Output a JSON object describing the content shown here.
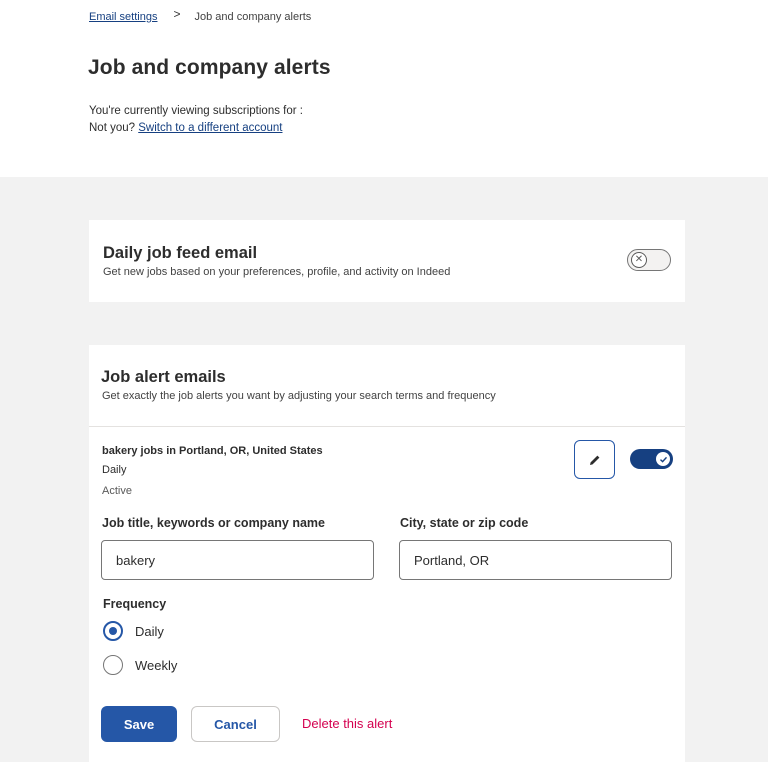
{
  "breadcrumb": {
    "link": "Email settings",
    "separator": ">",
    "current": "Job and company alerts"
  },
  "page": {
    "title": "Job and company alerts",
    "viewing_text": "You're currently viewing subscriptions for :",
    "not_you": "Not you?",
    "switch_link": "Switch to a different account"
  },
  "daily_feed": {
    "title": "Daily job feed email",
    "description": "Get new jobs based on your preferences, profile, and activity on Indeed",
    "toggle_state": "off"
  },
  "job_alerts": {
    "title": "Job alert emails",
    "description": "Get exactly the job alerts you want by adjusting your search terms and frequency",
    "alert": {
      "title": "bakery jobs in Portland, OR, United States",
      "frequency": "Daily",
      "status": "Active",
      "toggle_state": "on"
    },
    "form": {
      "keywords_label": "Job title, keywords or company name",
      "keywords_value": "bakery",
      "location_label": "City, state or zip code",
      "location_value": "Portland, OR",
      "frequency_label": "Frequency",
      "options": [
        {
          "label": "Daily",
          "checked": true
        },
        {
          "label": "Weekly",
          "checked": false
        }
      ],
      "save_label": "Save",
      "cancel_label": "Cancel",
      "delete_label": "Delete this alert"
    }
  },
  "colors": {
    "primary": "#2557a7",
    "toggle_on": "#164081",
    "delete": "#d4004f",
    "background_grey": "#f2f2f2"
  },
  "icons": {
    "edit": "pencil-icon",
    "toggle_off": "x-circle-icon",
    "toggle_on": "check-icon"
  }
}
